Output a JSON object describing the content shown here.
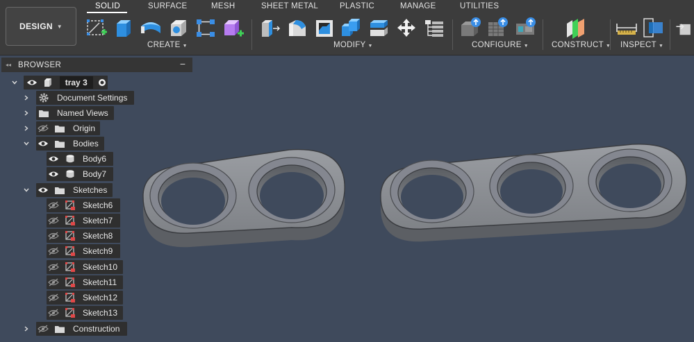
{
  "toolbar": {
    "workspace_label": "DESIGN",
    "tabs": [
      "SOLID",
      "SURFACE",
      "MESH",
      "SHEET METAL",
      "PLASTIC",
      "MANAGE",
      "UTILITIES"
    ],
    "groups": {
      "create": "CREATE",
      "modify": "MODIFY",
      "configure": "CONFIGURE",
      "construct": "CONSTRUCT",
      "inspect": "INSPECT"
    },
    "icons": {
      "create": [
        "create-sketch-icon",
        "extrude-icon",
        "revolve-icon",
        "hole-icon",
        "pattern-icon",
        "create-form-icon"
      ],
      "modify": [
        "press-pull-icon",
        "fillet-icon",
        "shell-icon",
        "combine-icon",
        "split-body-icon",
        "move-icon",
        "parameters-icon"
      ],
      "configure": [
        "configure-icon",
        "table-icon",
        "rule-icon"
      ],
      "construct": [
        "offset-plane-icon"
      ],
      "inspect": [
        "measure-icon",
        "interference-icon"
      ]
    }
  },
  "browser": {
    "title": "BROWSER",
    "root": "tray 3",
    "items": {
      "document_settings": "Document Settings",
      "named_views": "Named Views",
      "origin": "Origin",
      "bodies": "Bodies",
      "body6": "Body6",
      "body7": "Body7",
      "sketches": "Sketches",
      "construction": "Construction"
    },
    "sketches": [
      "Sketch6",
      "Sketch7",
      "Sketch8",
      "Sketch9",
      "Sketch10",
      "Sketch11",
      "Sketch12",
      "Sketch13"
    ]
  },
  "colors": {
    "viewport": "#3f4a5c",
    "toolbar": "#3c3c3c",
    "panel_node": "#2f2f2f",
    "accent_blue": "#3a8ee6",
    "model_gray": "#8e9196"
  }
}
